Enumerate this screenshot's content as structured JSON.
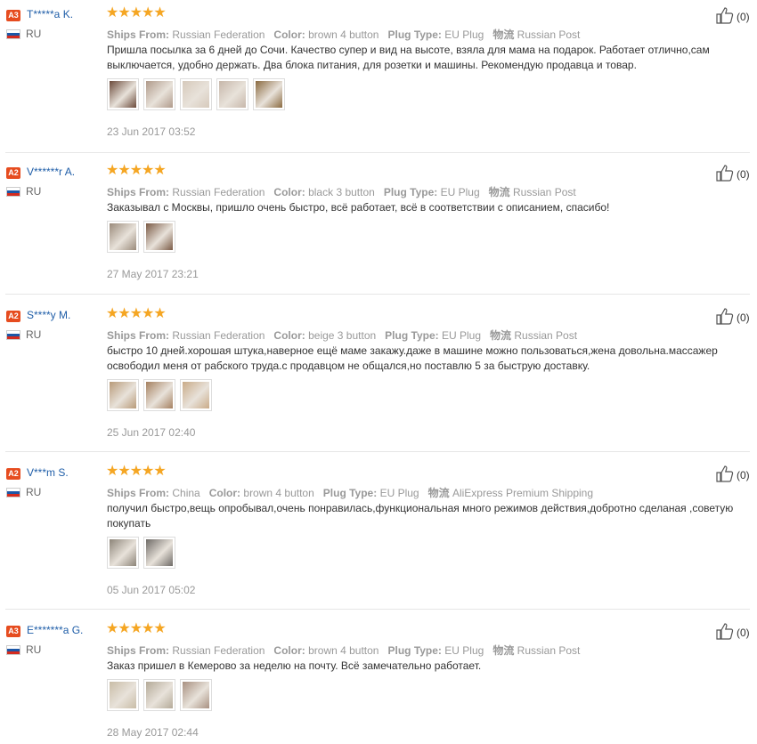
{
  "reviews": [
    {
      "badge": "A3",
      "badge_color": "#e64c1f",
      "username": "T*****a K.",
      "country": "RU",
      "stars": "★★★★★",
      "ships_label": "Ships From:",
      "ships": "Russian Federation",
      "color_label": "Color:",
      "color": "brown 4 button",
      "plug_label": "Plug Type:",
      "plug": "EU Plug",
      "logistics_label": "物流",
      "logistics": "Russian Post",
      "text": "Пришла посылка за 6 дней до Сочи. Качество супер и вид на высоте, взяла для мама на подарок. Работает отлично,сам выключается, удобно держать. Два блока питания, для розетки и машины. Рекомендую продавца и товар.",
      "date": "23 Jun 2017 03:52",
      "likes": "(0)",
      "photos": [
        "#6b4a3a",
        "#b09a8a",
        "#d6c9bb",
        "#c7b7aa",
        "#8a6a40"
      ]
    },
    {
      "badge": "A2",
      "badge_color": "#e64c1f",
      "username": "V******r A.",
      "country": "RU",
      "stars": "★★★★★",
      "ships_label": "Ships From:",
      "ships": "Russian Federation",
      "color_label": "Color:",
      "color": "black 3 button",
      "plug_label": "Plug Type:",
      "plug": "EU Plug",
      "logistics_label": "物流",
      "logistics": "Russian Post",
      "text": "Заказывал с Москвы, пришло очень быстро, всё работает, всё в соответствии с описанием, спасибо!",
      "date": "27 May 2017 23:21",
      "likes": "(0)",
      "photos": [
        "#9a8a7a",
        "#7a5a45"
      ]
    },
    {
      "badge": "A2",
      "badge_color": "#e64c1f",
      "username": "S****y M.",
      "country": "RU",
      "stars": "★★★★★",
      "ships_label": "Ships From:",
      "ships": "Russian Federation",
      "color_label": "Color:",
      "color": "beige 3 button",
      "plug_label": "Plug Type:",
      "plug": "EU Plug",
      "logistics_label": "物流",
      "logistics": "Russian Post",
      "text": "быстро 10 дней.хорошая штука,наверное ещё маме закажу.даже в машине можно пользоваться,жена довольна.массажер освободил меня от рабского труда.с продавцом не общался,но поставлю 5 за быструю доставку.",
      "date": "25 Jun 2017 02:40",
      "likes": "(0)",
      "photos": [
        "#b89a78",
        "#a58060",
        "#c9ab88"
      ]
    },
    {
      "badge": "A2",
      "badge_color": "#e64c1f",
      "username": "V***m S.",
      "country": "RU",
      "stars": "★★★★★",
      "ships_label": "Ships From:",
      "ships": "China",
      "color_label": "Color:",
      "color": "brown 4 button",
      "plug_label": "Plug Type:",
      "plug": "EU Plug",
      "logistics_label": "物流",
      "logistics": "AliExpress Premium Shipping",
      "text": "получил быстро,вещь опробывал,очень понравилась,функциональная много режимов действия,добротно сделаная ,советую покупать",
      "date": "05 Jun 2017 05:02",
      "likes": "(0)",
      "photos": [
        "#8c8478",
        "#6e6a66"
      ]
    },
    {
      "badge": "A3",
      "badge_color": "#e64c1f",
      "username": "E*******a G.",
      "country": "RU",
      "stars": "★★★★★",
      "ships_label": "Ships From:",
      "ships": "Russian Federation",
      "color_label": "Color:",
      "color": "brown 4 button",
      "plug_label": "Plug Type:",
      "plug": "EU Plug",
      "logistics_label": "物流",
      "logistics": "Russian Post",
      "text": "Заказ пришел в Кемерово за неделю на почту. Всё замечательно работает.",
      "date": "28 May 2017 02:44",
      "likes": "(0)",
      "photos": [
        "#c8bca6",
        "#b4aa98",
        "#a89080"
      ]
    }
  ]
}
